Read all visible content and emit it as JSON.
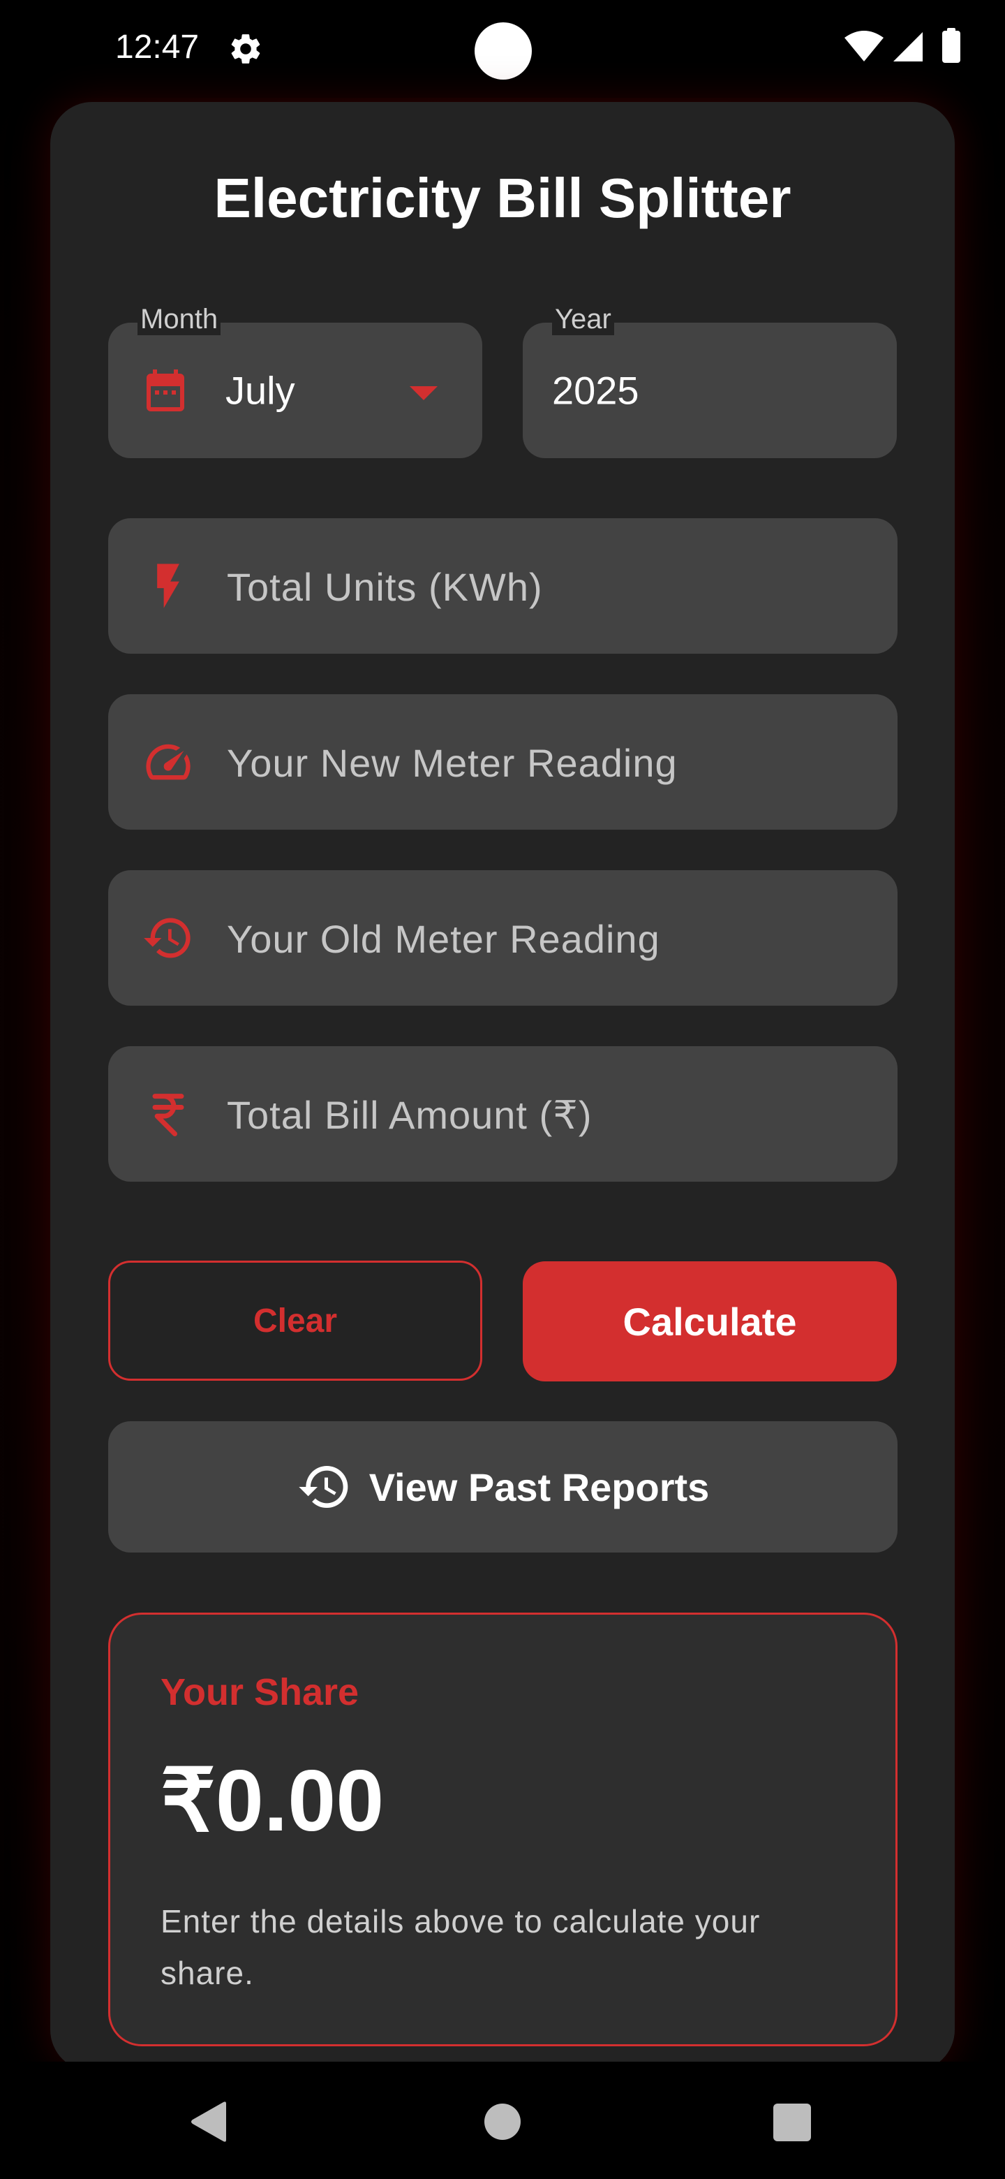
{
  "status_bar": {
    "time": "12:47",
    "icons": [
      "gear-icon",
      "wifi-icon",
      "signal-icon",
      "battery-icon"
    ]
  },
  "app": {
    "title": "Electricity Bill Splitter",
    "accent_color": "#d32f2f"
  },
  "month_field": {
    "label": "Month",
    "value": "July",
    "icon": "calendar-icon"
  },
  "year_field": {
    "label": "Year",
    "value": "2025"
  },
  "inputs": {
    "total_units": {
      "placeholder": "Total Units (KWh)",
      "icon": "bolt-icon"
    },
    "new_reading": {
      "placeholder": "Your New Meter Reading",
      "icon": "speedometer-icon"
    },
    "old_reading": {
      "placeholder": "Your Old Meter Reading",
      "icon": "history-icon"
    },
    "total_bill": {
      "placeholder": "Total Bill Amount (₹)",
      "icon": "rupee-icon"
    }
  },
  "buttons": {
    "clear": "Clear",
    "calculate": "Calculate",
    "past_reports": "View Past Reports"
  },
  "result": {
    "title": "Your Share",
    "amount": "₹0.00",
    "hint": "Enter the details above to calculate your share."
  },
  "nav_bar": {
    "icons": [
      "back-icon",
      "home-icon",
      "recents-icon"
    ]
  }
}
